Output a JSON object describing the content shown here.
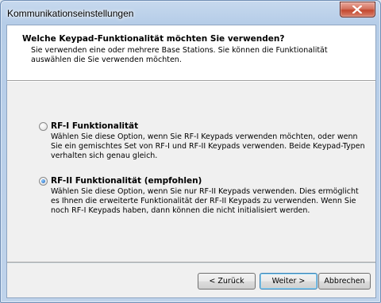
{
  "window": {
    "title": "Kommunikationseinstellungen"
  },
  "header": {
    "title": "Welche Keypad-Funktionalität möchten Sie verwenden?",
    "subtitle": "Sie verwenden eine oder mehrere Base Stations. Sie können die Funktionalität auswählen die Sie verwenden möchten."
  },
  "options": [
    {
      "label": "RF-I Funktionalität",
      "description": "Wählen Sie diese Option, wenn Sie RF-I Keypads verwenden möchten, oder wenn Sie ein gemischtes Set von RF-I und RF-II Keypads verwenden. Beide Keypad-Typen verhalten sich genau gleich.",
      "selected": false
    },
    {
      "label": "RF-II Funktionalität (empfohlen)",
      "description": "Wählen Sie diese Option, wenn Sie nur RF-II Keypads verwenden. Dies ermöglicht es Ihnen die erweiterte Funktionalität der RF-II Keypads zu verwenden. Wenn Sie noch RF-I Keypads haben, dann können die nicht initialisiert werden.",
      "selected": true
    }
  ],
  "buttons": {
    "back": "< Zurück",
    "next": "Weiter >",
    "cancel": "Abbrechen"
  },
  "colors": {
    "frame": "#bfd3eb",
    "close_button": "#c3482f",
    "radio_selected": "#1b5fb8"
  },
  "icons": {
    "close": "close-icon"
  }
}
